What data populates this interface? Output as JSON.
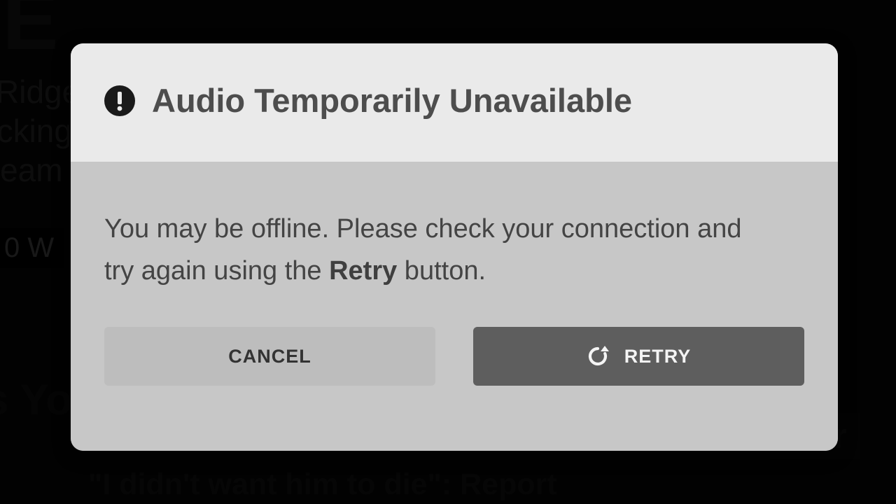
{
  "dialog": {
    "title": "Audio Temporarily Unavailable",
    "message_pre": "You may be offline. Please check your connection and try again using the ",
    "message_bold": "Retry",
    "message_post": " button.",
    "cancel_label": "CANCEL",
    "retry_label": "RETRY"
  },
  "background": {
    "frag_ge": "GE",
    "frag_l1": "Ridge",
    "frag_l2": "ocking",
    "frag_l3": "tream",
    "frag_ow": "0 W",
    "frag_gs": "gs Yo",
    "frag_quote": "\"I didn't want him to die\": Report",
    "frag_ster": "ster"
  }
}
